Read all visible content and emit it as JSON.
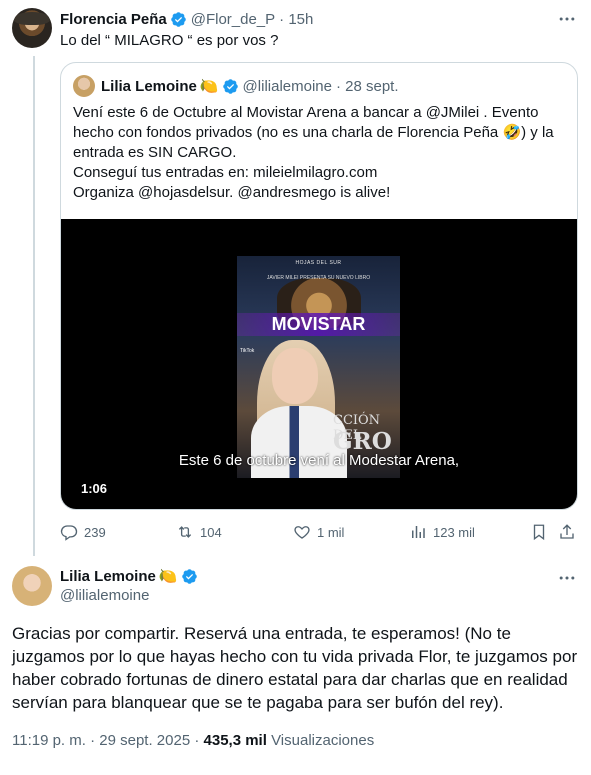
{
  "tweet1": {
    "name": "Florencia Peña",
    "handle": "@Flor_de_P",
    "time": "· 15h",
    "text": "Lo del “ MILAGRO “ es por vos ?"
  },
  "quote": {
    "name": "Lilia Lemoine",
    "emoji": "🍋",
    "handle": "@lilialemoine",
    "time": "· 28 sept.",
    "line1": "Vení este 6 de Octubre al Movistar Arena a bancar a @JMilei . Evento hecho con fondos privados (no es una charla de Florencia Peña 🤣) y la entrada es SIN CARGO.",
    "line2": "Conseguí tus entradas en: mileielmilagro.com",
    "line3": "Organiza @hojasdelsur. @andresmego is alive!",
    "video": {
      "poster_top": "JAVIER MILEI PRESENTA SU NUEVO LIBRO",
      "poster_brand": "HOJAS DEL SUR",
      "overlay_word": "MOVISTAR",
      "tiktok_label": "TikTok",
      "poster_title_a": "CCIÓN DEL",
      "poster_title_b": "GRO",
      "caption": "Este 6 de octubre vení al Modestar Arena,",
      "duration": "1:06"
    }
  },
  "actions": {
    "replies": "239",
    "reposts": "104",
    "likes": "1 mil",
    "views": "123 mil"
  },
  "tweet2": {
    "name": "Lilia Lemoine",
    "emoji": "🍋",
    "handle": "@lilialemoine",
    "text": "Gracias por compartir. Reservá una entrada, te esperamos! (No te juzgamos por lo que hayas hecho con tu vida privada Flor, te juzgamos por haber cobrado fortunas de dinero estatal para dar charlas que en realidad servían para blanquear que se te pagaba para ser bufón del rey).",
    "time": "11:19 p. m. · 29 sept. 2025 ·",
    "views_count": "435,3 mil",
    "views_label": "Visualizaciones"
  },
  "colors": {
    "verified": "#1d9bf0",
    "muted": "#536471",
    "border": "#cfd9de"
  }
}
